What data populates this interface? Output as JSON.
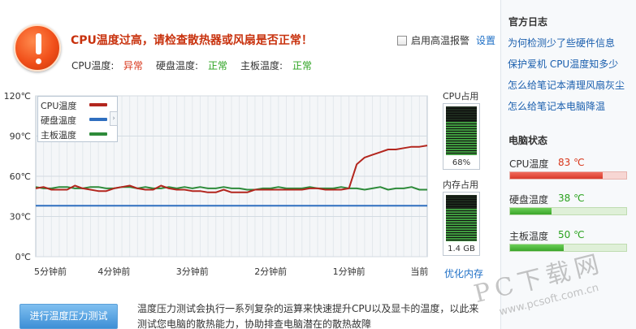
{
  "alert": {
    "icon": "exclamation-icon",
    "title": "CPU温度过高，请检查散热器或风扇是否正常！",
    "cpu_label": "CPU温度:",
    "cpu_status": "异常",
    "disk_label": "硬盘温度:",
    "disk_status": "正常",
    "board_label": "主板温度:",
    "board_status": "正常",
    "alarm_label": "启用高温报警",
    "settings_label": "设置"
  },
  "colors": {
    "warning": "#d8361a",
    "ok": "#2aa21e",
    "link": "#1e6fc6",
    "cpu_series": "#b3261e",
    "disk_series": "#2f6fbf",
    "board_series": "#2e8b3a"
  },
  "chart_data": {
    "type": "line",
    "title": "",
    "xlabel": "",
    "ylabel": "",
    "ylim": [
      0,
      120
    ],
    "y_ticks": [
      "120℃",
      "90℃",
      "60℃",
      "30℃",
      "0℃"
    ],
    "x_tick_labels": [
      "5分钟前",
      "4分钟前",
      "3分钟前",
      "2分钟前",
      "1分钟前",
      "当前"
    ],
    "x": [
      0,
      0.1,
      0.2,
      0.3,
      0.4,
      0.5,
      0.6,
      0.7,
      0.8,
      0.9,
      1.0,
      1.1,
      1.2,
      1.3,
      1.4,
      1.5,
      1.6,
      1.7,
      1.8,
      1.9,
      2.0,
      2.1,
      2.2,
      2.3,
      2.4,
      2.5,
      2.6,
      2.7,
      2.8,
      2.9,
      3.0,
      3.1,
      3.2,
      3.3,
      3.4,
      3.5,
      3.6,
      3.7,
      3.8,
      3.9,
      4.0,
      4.1,
      4.2,
      4.3,
      4.4,
      4.5,
      4.6,
      4.7,
      4.8,
      4.9,
      5.0
    ],
    "grid": true,
    "legend": "top-left",
    "series": [
      {
        "name": "CPU温度",
        "values": [
          51,
          52,
          50,
          50,
          50,
          53,
          51,
          50,
          49,
          49,
          51,
          52,
          53,
          51,
          50,
          50,
          53,
          51,
          50,
          50,
          49,
          49,
          48,
          48,
          50,
          48,
          48,
          48,
          50,
          50,
          50,
          50,
          50,
          50,
          50,
          51,
          51,
          50,
          50,
          50,
          51,
          69,
          74,
          76,
          78,
          80,
          80,
          81,
          82,
          82,
          83
        ]
      },
      {
        "name": "硬盘温度",
        "values": [
          38,
          38,
          38,
          38,
          38,
          38,
          38,
          38,
          38,
          38,
          38,
          38,
          38,
          38,
          38,
          38,
          38,
          38,
          38,
          38,
          38,
          38,
          38,
          38,
          38,
          38,
          38,
          38,
          38,
          38,
          38,
          38,
          38,
          38,
          38,
          38,
          38,
          38,
          38,
          38,
          38,
          38,
          38,
          38,
          38,
          38,
          38,
          38,
          38,
          38,
          38
        ]
      },
      {
        "name": "主板温度",
        "values": [
          52,
          51,
          51,
          52,
          52,
          51,
          51,
          52,
          52,
          51,
          51,
          52,
          52,
          51,
          52,
          51,
          51,
          52,
          51,
          52,
          51,
          52,
          51,
          51,
          52,
          51,
          51,
          50,
          50,
          51,
          51,
          52,
          51,
          51,
          51,
          52,
          51,
          51,
          51,
          52,
          51,
          51,
          50,
          51,
          52,
          50,
          51,
          51,
          52,
          50,
          50
        ]
      }
    ]
  },
  "usage": {
    "cpu_title": "CPU占用",
    "cpu_value": "68%",
    "cpu_fraction": 0.68,
    "mem_title": "内存占用",
    "mem_value": "1.4 GB",
    "mem_fraction": 0.7,
    "optimize_label": "优化内存"
  },
  "sidebar": {
    "blog_title": "官方日志",
    "links": [
      "为何检测少了些硬件信息",
      "保护爱机 CPU温度知多少",
      "怎么给笔记本清理风扇灰尘",
      "怎么给笔记本电脑降温"
    ],
    "status_title": "电脑状态",
    "temps": [
      {
        "label": "CPU温度",
        "value": "83 ℃",
        "fraction": 0.8,
        "state": "hot"
      },
      {
        "label": "硬盘温度",
        "value": "38 ℃",
        "fraction": 0.36,
        "state": "ok"
      },
      {
        "label": "主板温度",
        "value": "50 ℃",
        "fraction": 0.46,
        "state": "ok"
      }
    ]
  },
  "bottom": {
    "stress_button": "进行温度压力测试",
    "description": "温度压力测试会执行一系列复杂的运算来快速提升CPU以及显卡的温度，以此来测试您电脑的散热能力，协助排查电脑潜在的散热故障"
  },
  "watermark": {
    "main": "PC下载网",
    "url": "www.pcsoft.com.cn"
  }
}
